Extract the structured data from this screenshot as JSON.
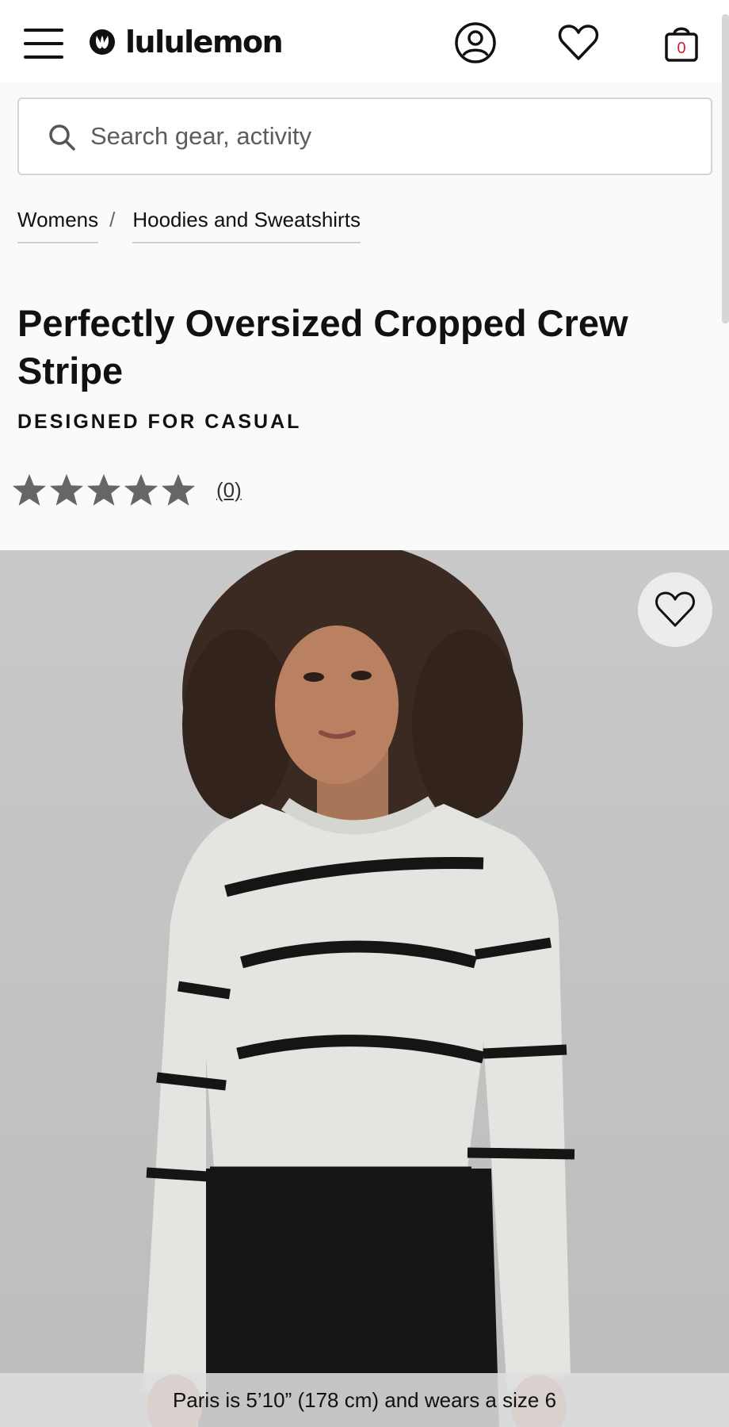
{
  "header": {
    "brand": "lululemon",
    "menu_icon": "hamburger-menu-icon",
    "account_icon": "account-icon",
    "wishlist_icon": "heart-icon",
    "bag_icon": "shopping-bag-icon",
    "bag_count": "0"
  },
  "search": {
    "placeholder": "Search gear, activity",
    "value": ""
  },
  "breadcrumb": {
    "items": [
      "Womens",
      "Hoodies and Sweatshirts"
    ],
    "separator": "/"
  },
  "product": {
    "title": "Perfectly Oversized Cropped Crew Stripe",
    "activity": "DESIGNED FOR CASUAL",
    "rating_stars": 5,
    "rating_value": 0,
    "review_count": "(0)"
  },
  "hero": {
    "model_caption": "Paris is 5’10” (178 cm) and wears a size 6",
    "wishlist_icon": "heart-icon"
  },
  "colors": {
    "background": "#fafafa",
    "star": "#666666",
    "bag_count": "#d31f2e"
  }
}
